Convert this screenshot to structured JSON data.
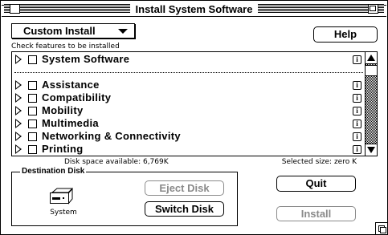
{
  "window": {
    "title": "Install System Software"
  },
  "install_mode": {
    "selected": "Custom Install"
  },
  "help_label": "Help",
  "caption": "Check features to be installed",
  "features": [
    {
      "label": "System Software",
      "checked": false
    },
    {
      "label": "Assistance",
      "checked": false
    },
    {
      "label": "Compatibility",
      "checked": false
    },
    {
      "label": "Mobility",
      "checked": false
    },
    {
      "label": "Multimedia",
      "checked": false
    },
    {
      "label": "Networking & Connectivity",
      "checked": false
    },
    {
      "label": "Printing",
      "checked": false
    }
  ],
  "info_glyph": "i",
  "disk_space": "Disk space available: 6,769K",
  "selected_size": "Selected size: zero K",
  "destination": {
    "title": "Destination Disk",
    "disk_name": "System",
    "eject_label": "Eject Disk",
    "switch_label": "Switch Disk"
  },
  "quit_label": "Quit",
  "install_label": "Install",
  "colors": {
    "disabled": "#8a8a8a",
    "frame": "#000000",
    "background": "#ffffff"
  }
}
